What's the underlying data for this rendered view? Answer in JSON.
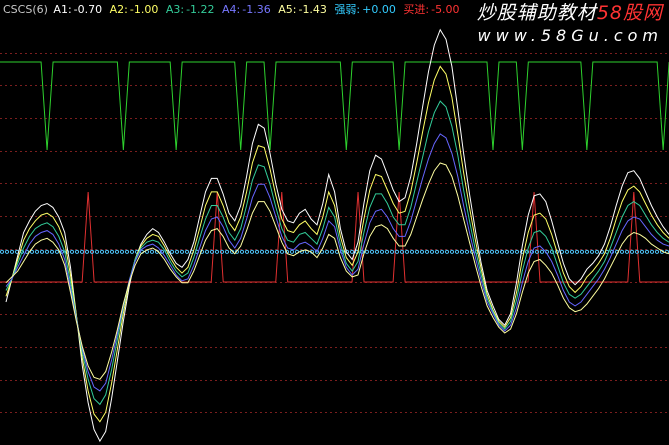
{
  "colors": {
    "background": "#000000",
    "grid": "#7a1e1e",
    "green_line": "#2ed12e",
    "red_line": "#e03030",
    "baseline_dots": "#4fc3f7",
    "a1": "#ffffff",
    "a2": "#ffff66",
    "a3": "#33cc99",
    "a4": "#6666ff",
    "a5": "#ffffa0",
    "strength": "#33ccff",
    "signal": "#ff3333",
    "watermark_accent": "#ff3333"
  },
  "legend": {
    "title": "CSCS(6)",
    "a1_label": "A1:",
    "a1_value": "-0.70",
    "a2_label": "A2:",
    "a2_value": "-1.00",
    "a3_label": "A3:",
    "a3_value": "-1.22",
    "a4_label": "A4:",
    "a4_value": "-1.36",
    "a5_label": "A5:",
    "a5_value": "-1.43",
    "strength_label": "强弱:",
    "strength_value": "+0.00",
    "signal_label": "买进:",
    "signal_value": "-5.00"
  },
  "watermark": {
    "line1_prefix": "炒股辅助教材",
    "line1_accent": "58股网",
    "line2": "www.58Gu.com"
  },
  "chart_data": {
    "type": "line",
    "title": "CSCS(6)",
    "ylim": [
      -10,
      12
    ],
    "baseline": 0,
    "n": 114,
    "series": [
      {
        "name": "A1",
        "color": "#ffffff",
        "values": [
          -2.6,
          -1.4,
          -0.2,
          1.0,
          1.6,
          2.1,
          2.4,
          2.5,
          2.3,
          1.8,
          1.0,
          -0.8,
          -3.3,
          -5.9,
          -7.8,
          -9.2,
          -9.8,
          -9.3,
          -7.6,
          -5.6,
          -3.6,
          -1.8,
          -0.4,
          0.4,
          0.9,
          1.2,
          1.0,
          0.5,
          -0.1,
          -0.6,
          -0.8,
          -0.4,
          0.5,
          1.8,
          3.1,
          3.8,
          3.8,
          3.0,
          2.0,
          1.6,
          2.4,
          3.9,
          5.6,
          6.6,
          6.4,
          5.1,
          3.5,
          2.2,
          1.6,
          1.5,
          2.0,
          2.2,
          1.7,
          1.4,
          2.5,
          4.0,
          3.1,
          1.2,
          0.0,
          -0.4,
          0.5,
          2.5,
          4.2,
          5.0,
          4.8,
          4.0,
          3.2,
          2.6,
          2.8,
          3.9,
          5.6,
          7.5,
          9.3,
          10.7,
          11.5,
          11.0,
          9.6,
          7.4,
          5.1,
          3.0,
          1.1,
          -0.6,
          -2.0,
          -2.8,
          -3.5,
          -3.8,
          -3.2,
          -1.6,
          0.3,
          1.9,
          2.9,
          3.0,
          2.6,
          1.6,
          0.5,
          -0.6,
          -1.4,
          -1.7,
          -1.4,
          -0.9,
          -0.6,
          -0.2,
          0.4,
          1.3,
          2.4,
          3.4,
          4.1,
          4.2,
          3.8,
          3.1,
          2.4,
          1.8,
          1.3,
          0.9
        ]
      },
      {
        "name": "A2",
        "color": "#ffff66",
        "values": [
          -2.3,
          -1.4,
          -0.4,
          0.6,
          1.2,
          1.6,
          1.9,
          2.0,
          1.8,
          1.3,
          0.5,
          -1.2,
          -3.3,
          -5.5,
          -7.2,
          -8.4,
          -8.8,
          -8.3,
          -6.8,
          -5.0,
          -3.2,
          -1.6,
          -0.4,
          0.3,
          0.7,
          0.9,
          0.8,
          0.3,
          -0.3,
          -0.8,
          -1.1,
          -0.8,
          0.1,
          1.2,
          2.4,
          3.1,
          3.1,
          2.4,
          1.5,
          1.1,
          1.8,
          3.1,
          4.6,
          5.5,
          5.4,
          4.3,
          2.9,
          1.7,
          1.1,
          1.0,
          1.4,
          1.6,
          1.2,
          0.9,
          1.8,
          3.1,
          2.4,
          0.8,
          -0.3,
          -0.7,
          0.0,
          1.7,
          3.2,
          4.0,
          3.9,
          3.2,
          2.5,
          2.0,
          2.1,
          3.1,
          4.6,
          6.2,
          7.7,
          8.9,
          9.6,
          9.2,
          8.0,
          6.1,
          4.1,
          2.3,
          0.6,
          -0.9,
          -2.2,
          -3.0,
          -3.6,
          -3.9,
          -3.4,
          -2.1,
          -0.4,
          1.0,
          1.9,
          2.0,
          1.7,
          0.9,
          -0.1,
          -1.1,
          -1.8,
          -2.1,
          -1.8,
          -1.3,
          -1.0,
          -0.6,
          -0.1,
          0.7,
          1.7,
          2.6,
          3.2,
          3.4,
          3.1,
          2.5,
          1.9,
          1.4,
          1.0,
          0.7
        ]
      },
      {
        "name": "A3",
        "color": "#33cc99",
        "values": [
          -2.0,
          -1.4,
          -0.6,
          0.2,
          0.8,
          1.2,
          1.4,
          1.5,
          1.3,
          0.8,
          0.0,
          -1.6,
          -3.4,
          -5.2,
          -6.6,
          -7.6,
          -7.9,
          -7.4,
          -6.1,
          -4.5,
          -2.9,
          -1.5,
          -0.4,
          0.2,
          0.5,
          0.6,
          0.5,
          0.1,
          -0.5,
          -1.0,
          -1.3,
          -1.1,
          -0.3,
          0.7,
          1.7,
          2.4,
          2.4,
          1.8,
          1.0,
          0.6,
          1.2,
          2.4,
          3.7,
          4.5,
          4.4,
          3.5,
          2.3,
          1.2,
          0.6,
          0.5,
          0.9,
          1.0,
          0.7,
          0.4,
          1.2,
          2.3,
          1.8,
          0.4,
          -0.6,
          -1.0,
          -0.5,
          1.0,
          2.3,
          3.0,
          3.0,
          2.5,
          1.8,
          1.4,
          1.4,
          2.3,
          3.6,
          4.9,
          6.2,
          7.2,
          7.8,
          7.5,
          6.5,
          5.0,
          3.2,
          1.6,
          0.1,
          -1.2,
          -2.4,
          -3.1,
          -3.7,
          -4.0,
          -3.6,
          -2.5,
          -1.0,
          0.2,
          1.0,
          1.1,
          0.8,
          0.2,
          -0.7,
          -1.6,
          -2.2,
          -2.4,
          -2.2,
          -1.8,
          -1.4,
          -1.0,
          -0.5,
          0.2,
          1.0,
          1.8,
          2.4,
          2.6,
          2.4,
          1.9,
          1.4,
          1.0,
          0.7,
          0.5
        ]
      },
      {
        "name": "A4",
        "color": "#6666ff",
        "values": [
          -1.8,
          -1.4,
          -0.8,
          -0.2,
          0.4,
          0.8,
          1.0,
          1.1,
          0.9,
          0.4,
          -0.4,
          -1.9,
          -3.5,
          -5.0,
          -6.2,
          -7.0,
          -7.2,
          -6.8,
          -5.6,
          -4.2,
          -2.8,
          -1.5,
          -0.5,
          0.1,
          0.3,
          0.4,
          0.2,
          -0.2,
          -0.7,
          -1.2,
          -1.5,
          -1.4,
          -0.7,
          0.2,
          1.1,
          1.7,
          1.8,
          1.3,
          0.6,
          0.2,
          0.7,
          1.7,
          2.8,
          3.5,
          3.5,
          2.8,
          1.8,
          0.8,
          0.2,
          0.1,
          0.4,
          0.5,
          0.3,
          0.0,
          0.7,
          1.6,
          1.3,
          0.1,
          -0.8,
          -1.2,
          -0.9,
          0.4,
          1.5,
          2.1,
          2.2,
          1.8,
          1.2,
          0.8,
          0.8,
          1.6,
          2.7,
          3.8,
          4.8,
          5.6,
          6.1,
          5.9,
          5.1,
          3.9,
          2.4,
          1.0,
          -0.3,
          -1.5,
          -2.6,
          -3.2,
          -3.8,
          -4.1,
          -3.8,
          -2.9,
          -1.6,
          -0.5,
          0.2,
          0.3,
          0.0,
          -0.5,
          -1.2,
          -2.0,
          -2.6,
          -2.8,
          -2.6,
          -2.2,
          -1.8,
          -1.4,
          -0.9,
          -0.3,
          0.4,
          1.1,
          1.6,
          1.8,
          1.7,
          1.3,
          0.9,
          0.6,
          0.4,
          0.3
        ]
      },
      {
        "name": "A5",
        "color": "#ffffa0",
        "values": [
          -1.6,
          -1.3,
          -1.0,
          -0.5,
          0.0,
          0.4,
          0.6,
          0.7,
          0.5,
          0.1,
          -0.7,
          -2.1,
          -3.6,
          -4.9,
          -5.9,
          -6.5,
          -6.6,
          -6.2,
          -5.2,
          -4.0,
          -2.7,
          -1.6,
          -0.7,
          -0.1,
          0.1,
          0.2,
          0.0,
          -0.4,
          -0.9,
          -1.3,
          -1.6,
          -1.6,
          -1.0,
          -0.2,
          0.6,
          1.1,
          1.2,
          0.8,
          0.2,
          -0.1,
          0.3,
          1.1,
          2.0,
          2.6,
          2.6,
          2.1,
          1.3,
          0.5,
          -0.1,
          -0.2,
          0.0,
          0.1,
          0.0,
          -0.3,
          0.2,
          0.9,
          0.7,
          -0.3,
          -1.0,
          -1.3,
          -1.2,
          -0.1,
          0.8,
          1.3,
          1.4,
          1.2,
          0.7,
          0.3,
          0.3,
          0.9,
          1.8,
          2.7,
          3.5,
          4.2,
          4.6,
          4.5,
          3.9,
          2.9,
          1.7,
          0.5,
          -0.7,
          -1.8,
          -2.8,
          -3.4,
          -3.9,
          -4.2,
          -4.0,
          -3.2,
          -2.1,
          -1.1,
          -0.5,
          -0.4,
          -0.7,
          -1.1,
          -1.7,
          -2.4,
          -2.9,
          -3.1,
          -3.0,
          -2.7,
          -2.3,
          -1.9,
          -1.4,
          -0.8,
          -0.2,
          0.4,
          0.8,
          1.0,
          0.9,
          0.7,
          0.4,
          0.2,
          0.0,
          -0.1
        ]
      }
    ],
    "green_dips": [
      7,
      20,
      29,
      40,
      45,
      58,
      67,
      83,
      88,
      99,
      112
    ],
    "red_peaks": [
      14,
      36,
      47,
      60,
      67,
      90,
      107
    ]
  }
}
